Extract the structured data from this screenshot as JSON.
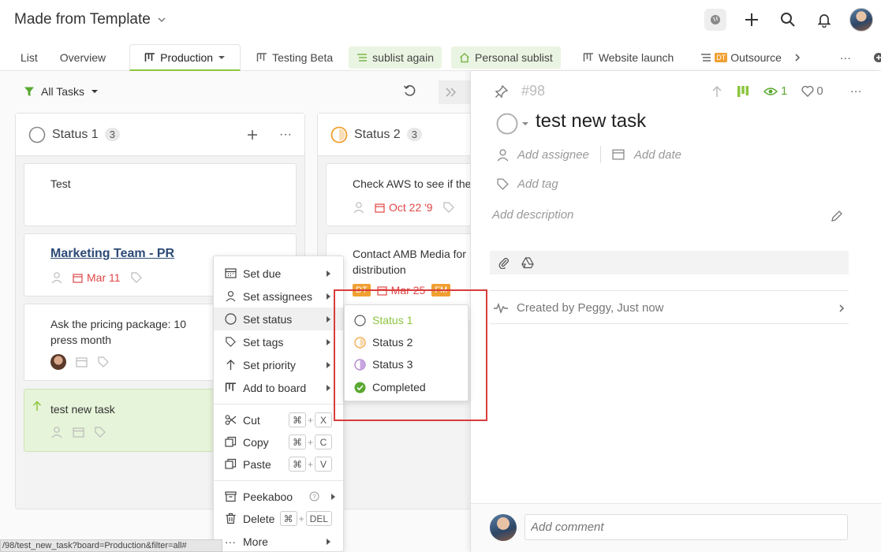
{
  "header": {
    "project_title": "Made from Template",
    "tabs": [
      {
        "label": "List"
      },
      {
        "label": "Overview"
      },
      {
        "label": "Production"
      },
      {
        "label": "Testing Beta"
      },
      {
        "label": "sublist again"
      },
      {
        "label": "Personal sublist"
      },
      {
        "label": "Website launch"
      },
      {
        "label": "Outsource",
        "badge": "DT"
      }
    ],
    "more": "···"
  },
  "board": {
    "filter_label": "All Tasks",
    "columns": [
      {
        "title": "Status 1",
        "count": "3",
        "cards": [
          {
            "title": "Test"
          },
          {
            "title": "Marketing Team - PR",
            "date": "Mar 11"
          },
          {
            "title": "Ask the pricing package: 10 press month"
          },
          {
            "title": "test new task"
          }
        ]
      },
      {
        "title": "Status 2",
        "count": "3",
        "cards": [
          {
            "title": "Check AWS to see if the",
            "date": "Oct 22 '9"
          },
          {
            "title": "Contact AMB Media for distribution",
            "badge1": "DT",
            "date": "Mar 25",
            "badge2": "FM"
          }
        ]
      }
    ]
  },
  "context_menu": {
    "items": [
      {
        "label": "Set due"
      },
      {
        "label": "Set assignees"
      },
      {
        "label": "Set status"
      },
      {
        "label": "Set tags"
      },
      {
        "label": "Set priority"
      },
      {
        "label": "Add to board"
      }
    ],
    "clipboard": [
      {
        "label": "Cut",
        "key": "X"
      },
      {
        "label": "Copy",
        "key": "C"
      },
      {
        "label": "Paste",
        "key": "V"
      }
    ],
    "cmd_symbol": "⌘",
    "plus": "+",
    "peekaboo": "Peekaboo",
    "delete": {
      "label": "Delete",
      "key": "DEL"
    },
    "more": "More"
  },
  "status_submenu": {
    "items": [
      {
        "label": "Status 1",
        "color": "#8cc63e"
      },
      {
        "label": "Status 2",
        "color": "#333333"
      },
      {
        "label": "Status 3",
        "color": "#333333"
      },
      {
        "label": "Completed",
        "color": "#333333"
      }
    ]
  },
  "detail": {
    "task_id": "#98",
    "watchers": "1",
    "likes": "0",
    "title": "test new task",
    "add_assignee": "Add assignee",
    "add_date": "Add date",
    "add_tag": "Add tag",
    "add_description": "Add description",
    "activity": "Created by Peggy, Just now",
    "comment_placeholder": "Add comment"
  },
  "status_bar": {
    "url": "/98/test_new_task?board=Production&filter=all#"
  },
  "colors": {
    "accent_green": "#8cc63e",
    "date_red": "#e04646",
    "badge_orange": "#f0a032",
    "highlight_red": "#d93c3c"
  }
}
